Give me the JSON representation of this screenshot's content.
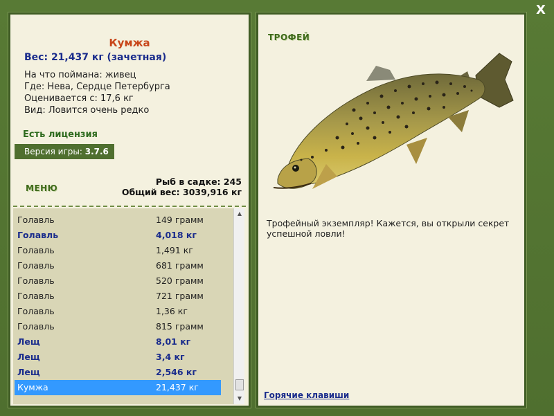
{
  "window": {
    "close_label": "X"
  },
  "fish": {
    "name": "Кумжа",
    "weight": "Вес: 21,437 кг (зачетная)",
    "caught_on": "На что поймана: живец",
    "where": "Где: Нева, Сердце Петербурга",
    "valued_from": "Оценивается с: 17,6 кг",
    "species": "Вид: Ловится очень редко"
  },
  "license": "Есть лицензия",
  "version": {
    "label": "Версия игры:",
    "value": "3.7.6"
  },
  "menu_label": "МЕНЮ",
  "stats": {
    "fish_in_keepnet": "Рыб в садке: 245",
    "total_weight": "Общий вес: 3039,916 кг"
  },
  "fish_list": [
    {
      "name": "Голавль",
      "weight": "149 грамм",
      "bold": false,
      "selected": false
    },
    {
      "name": "Голавль",
      "weight": "4,018 кг",
      "bold": true,
      "selected": false
    },
    {
      "name": "Голавль",
      "weight": "1,491 кг",
      "bold": false,
      "selected": false
    },
    {
      "name": "Голавль",
      "weight": "681 грамм",
      "bold": false,
      "selected": false
    },
    {
      "name": "Голавль",
      "weight": "520 грамм",
      "bold": false,
      "selected": false
    },
    {
      "name": "Голавль",
      "weight": "721 грамм",
      "bold": false,
      "selected": false
    },
    {
      "name": "Голавль",
      "weight": "1,36 кг",
      "bold": false,
      "selected": false
    },
    {
      "name": "Голавль",
      "weight": "815 грамм",
      "bold": false,
      "selected": false
    },
    {
      "name": "Лещ",
      "weight": "8,01 кг",
      "bold": true,
      "selected": false
    },
    {
      "name": "Лещ",
      "weight": "3,4 кг",
      "bold": true,
      "selected": false
    },
    {
      "name": "Лещ",
      "weight": "2,546 кг",
      "bold": true,
      "selected": false
    },
    {
      "name": "Кумжа",
      "weight": "21,437 кг",
      "bold": false,
      "selected": true
    }
  ],
  "trophy": {
    "label": "ТРОФЕЙ",
    "text": "Трофейный экземпляр! Кажется, вы открыли секрет успешной ловли!"
  },
  "hotkeys_link": "Горячие клавиши",
  "colors": {
    "frame": "#4f6f2f",
    "panel": "#f4f1df",
    "list_bg": "#d9d6b6",
    "selection": "#3399ff",
    "title": "#c8461a",
    "bold_text": "#1a2c8c"
  }
}
